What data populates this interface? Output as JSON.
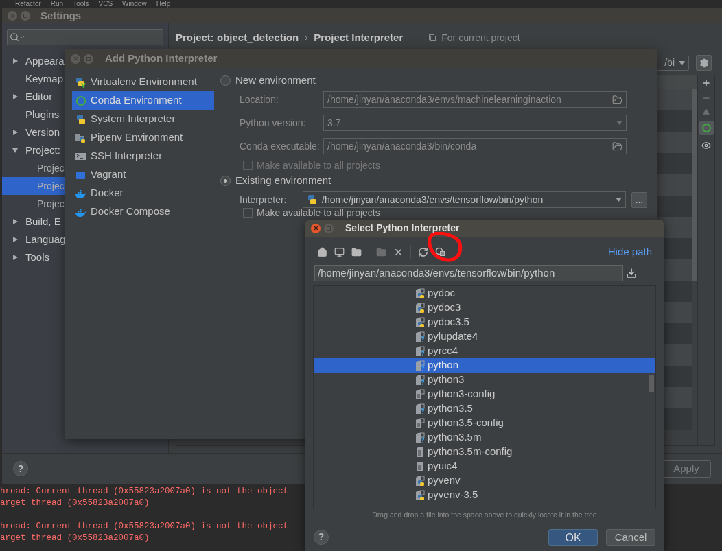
{
  "menu_bar": [
    "Refactor",
    "Run",
    "Tools",
    "VCS",
    "Window",
    "Help"
  ],
  "settings": {
    "title": "Settings",
    "tree": [
      {
        "label": "Appeara",
        "kind": "group",
        "expanded": false,
        "selected": false
      },
      {
        "label": "Keymap",
        "kind": "leaf",
        "selected": false
      },
      {
        "label": "Editor",
        "kind": "group",
        "expanded": false,
        "selected": false
      },
      {
        "label": "Plugins",
        "kind": "leaf",
        "selected": false
      },
      {
        "label": "Version",
        "kind": "group",
        "expanded": false,
        "selected": false
      },
      {
        "label": "Project:",
        "kind": "group",
        "expanded": true,
        "selected": false,
        "children": [
          {
            "label": "Projec",
            "selected": false
          },
          {
            "label": "Projec",
            "selected": true
          },
          {
            "label": "Projec",
            "selected": false
          }
        ]
      },
      {
        "label": "Build, E",
        "kind": "group",
        "expanded": false,
        "selected": false
      },
      {
        "label": "Languag",
        "kind": "group",
        "expanded": false,
        "selected": false
      },
      {
        "label": "Tools",
        "kind": "group",
        "expanded": false,
        "selected": false
      }
    ],
    "breadcrumb": [
      "Project: object_detection",
      "Project Interpreter"
    ],
    "scope": "For current project",
    "interpreter_value": "/bi",
    "apply": "Apply",
    "help": "?"
  },
  "add_dialog": {
    "title": "Add Python Interpreter",
    "types": [
      {
        "label": "Virtualenv Environment",
        "kind": "virtualenv",
        "selected": false
      },
      {
        "label": "Conda Environment",
        "kind": "conda",
        "selected": true
      },
      {
        "label": "System Interpreter",
        "kind": "python",
        "selected": false
      },
      {
        "label": "Pipenv Environment",
        "kind": "pipenv",
        "selected": false
      },
      {
        "label": "SSH Interpreter",
        "kind": "ssh",
        "selected": false
      },
      {
        "label": "Vagrant",
        "kind": "vagrant",
        "selected": false
      },
      {
        "label": "Docker",
        "kind": "docker",
        "selected": false
      },
      {
        "label": "Docker Compose",
        "kind": "docker",
        "selected": false
      }
    ],
    "new_environment": {
      "label": "New environment",
      "selected": false,
      "fields": [
        {
          "label": "Location:",
          "value": "/home/jinyan/anaconda3/envs/machinelearninginaction",
          "kind": "folder"
        },
        {
          "label": "Python version:",
          "value": "3.7",
          "kind": "dropdown"
        },
        {
          "label": "Conda executable:",
          "value": "/home/jinyan/anaconda3/bin/conda",
          "kind": "folder"
        }
      ],
      "make_available": {
        "label": "Make available to all projects",
        "checked": false
      }
    },
    "existing_environment": {
      "label": "Existing environment",
      "selected": true,
      "interpreter_label": "Interpreter:",
      "interpreter_value": "/home/jinyan/anaconda3/envs/tensorflow/bin/python",
      "browse": "...",
      "make_available": {
        "label": "Make available to all projects",
        "checked": false
      }
    }
  },
  "select_dialog": {
    "title": "Select Python Interpreter",
    "hide_path": "Hide path",
    "path": "/home/jinyan/anaconda3/envs/tensorflow/bin/python",
    "files": [
      {
        "name": "pydoc",
        "kind": "python",
        "selected": false
      },
      {
        "name": "pydoc3",
        "kind": "python",
        "selected": false
      },
      {
        "name": "pydoc3.5",
        "kind": "python",
        "selected": false
      },
      {
        "name": "pylupdate4",
        "kind": "unknown",
        "selected": false
      },
      {
        "name": "pyrcc4",
        "kind": "unknown",
        "selected": false
      },
      {
        "name": "python",
        "kind": "unknown",
        "selected": true
      },
      {
        "name": "python3",
        "kind": "unknown",
        "selected": false
      },
      {
        "name": "python3-config",
        "kind": "script",
        "selected": false
      },
      {
        "name": "python3.5",
        "kind": "unknown",
        "selected": false
      },
      {
        "name": "python3.5-config",
        "kind": "script",
        "selected": false
      },
      {
        "name": "python3.5m",
        "kind": "unknown",
        "selected": false
      },
      {
        "name": "python3.5m-config",
        "kind": "text",
        "selected": false
      },
      {
        "name": "pyuic4",
        "kind": "text",
        "selected": false
      },
      {
        "name": "pyvenv",
        "kind": "python",
        "selected": false
      },
      {
        "name": "pyvenv-3.5",
        "kind": "python",
        "selected": false
      }
    ],
    "hint": "Drag and drop a file into the space above to quickly locate it in the tree",
    "help": "?",
    "ok": "OK",
    "cancel": "Cancel"
  },
  "console": [
    {
      "lines": [
        "hread: Current thread (0x55823a2007a0) is not the object",
        "arget thread (0x55823a2007a0)"
      ]
    },
    {
      "lines": [
        "hread: Current thread (0x55823a2007a0) is not the object",
        "arget thread (0x55823a2007a0)"
      ]
    }
  ]
}
